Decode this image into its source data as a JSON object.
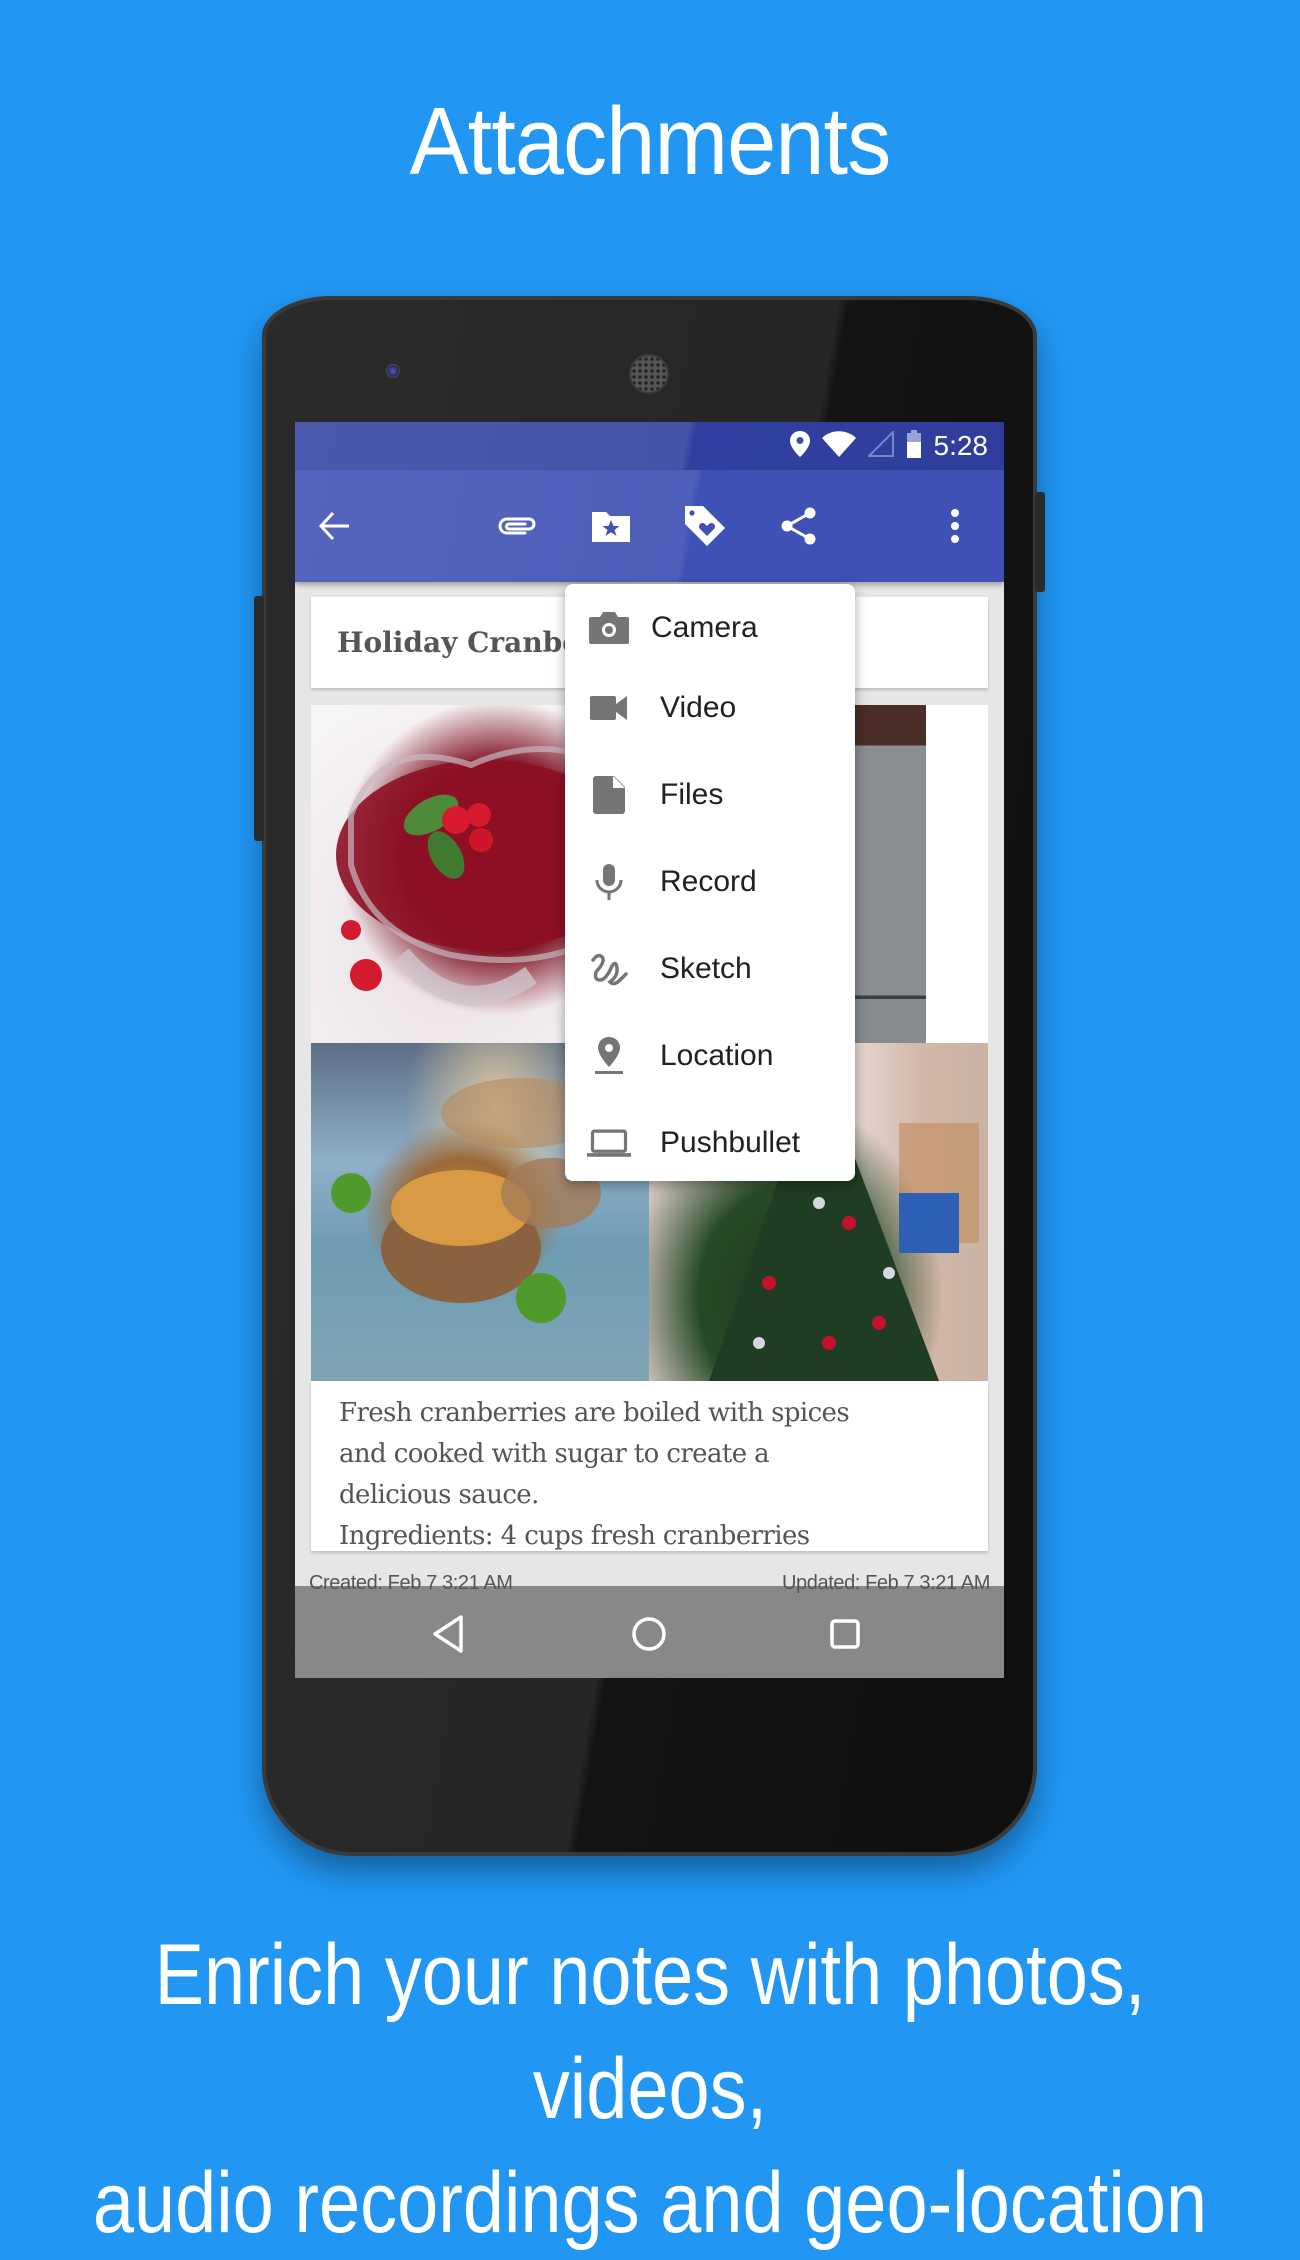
{
  "promo": {
    "headline": "Attachments",
    "tagline_line1": "Enrich your notes with photos, videos,",
    "tagline_line2": "audio recordings and geo-location",
    "background_color": "#2196F3"
  },
  "status_bar": {
    "time": "5:28",
    "icons": [
      "location-icon",
      "wifi-icon",
      "cell-signal-icon",
      "battery-icon"
    ]
  },
  "toolbar": {
    "icons": [
      "back-arrow-icon",
      "attachment-icon",
      "category-folder-icon",
      "tag-icon",
      "share-icon",
      "more-vert-icon"
    ],
    "color": "#3F51B5"
  },
  "note": {
    "title": "Holiday Cranberry Sauce",
    "title_visible": "Holiday Cranbe",
    "body": "Fresh cranberries are boiled with spices\nand cooked with sugar to create a\ndelicious sauce.\nIngredients: 4 cups fresh cranberries",
    "created": "Created: Feb 7 3:21 AM",
    "updated": "Updated: Feb 7 3:21 AM",
    "images": [
      "cranberry-sauce-photo",
      "kitchen-photo",
      "stuffed-mushrooms-photo",
      "christmas-tree-photo"
    ]
  },
  "attach_menu": {
    "items": [
      {
        "label": "Camera",
        "icon": "camera-icon"
      },
      {
        "label": "Video",
        "icon": "videocam-icon"
      },
      {
        "label": "Files",
        "icon": "file-icon"
      },
      {
        "label": "Record",
        "icon": "mic-icon"
      },
      {
        "label": "Sketch",
        "icon": "gesture-icon"
      },
      {
        "label": "Location",
        "icon": "pin-drop-icon"
      },
      {
        "label": "Pushbullet",
        "icon": "laptop-icon"
      }
    ]
  },
  "nav_bar": {
    "buttons": [
      "back-triangle-icon",
      "home-circle-icon",
      "recents-square-icon"
    ]
  }
}
